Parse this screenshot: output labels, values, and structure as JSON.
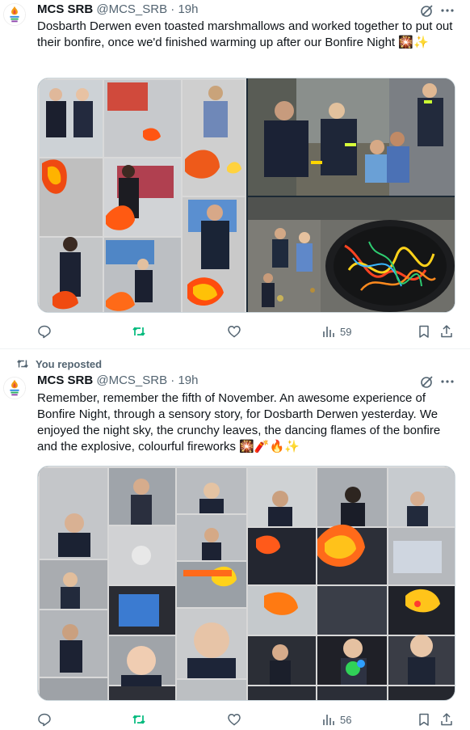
{
  "tweets": [
    {
      "display_name": "MCS SRB",
      "handle": "@MCS_SRB",
      "separator": "·",
      "time": "19h",
      "text": "Dosbarth Derwen even toasted marshmallows and worked together to put out their bonfire, once we'd finished warming up after our Bonfire Night 🎇✨",
      "views": "59"
    },
    {
      "repost_label": "You reposted",
      "display_name": "MCS SRB",
      "handle": "@MCS_SRB",
      "separator": "·",
      "time": "19h",
      "text": "Remember, remember the fifth of November. An awesome experience of Bonfire Night, through a sensory story, for Dosbarth Derwen yesterday. We enjoyed the night sky, the crunchy leaves, the dancing flames of the bonfire and the explosive, colourful fireworks 🎇🧨🔥✨",
      "views": "56"
    }
  ],
  "colors": {
    "accent_green": "#00ba7c",
    "icon_gray": "#536471",
    "border": "#cfd9de"
  },
  "icons": [
    "grok-icon",
    "more-icon",
    "reply-icon",
    "repost-icon",
    "like-icon",
    "views-icon",
    "bookmark-icon",
    "share-icon"
  ]
}
